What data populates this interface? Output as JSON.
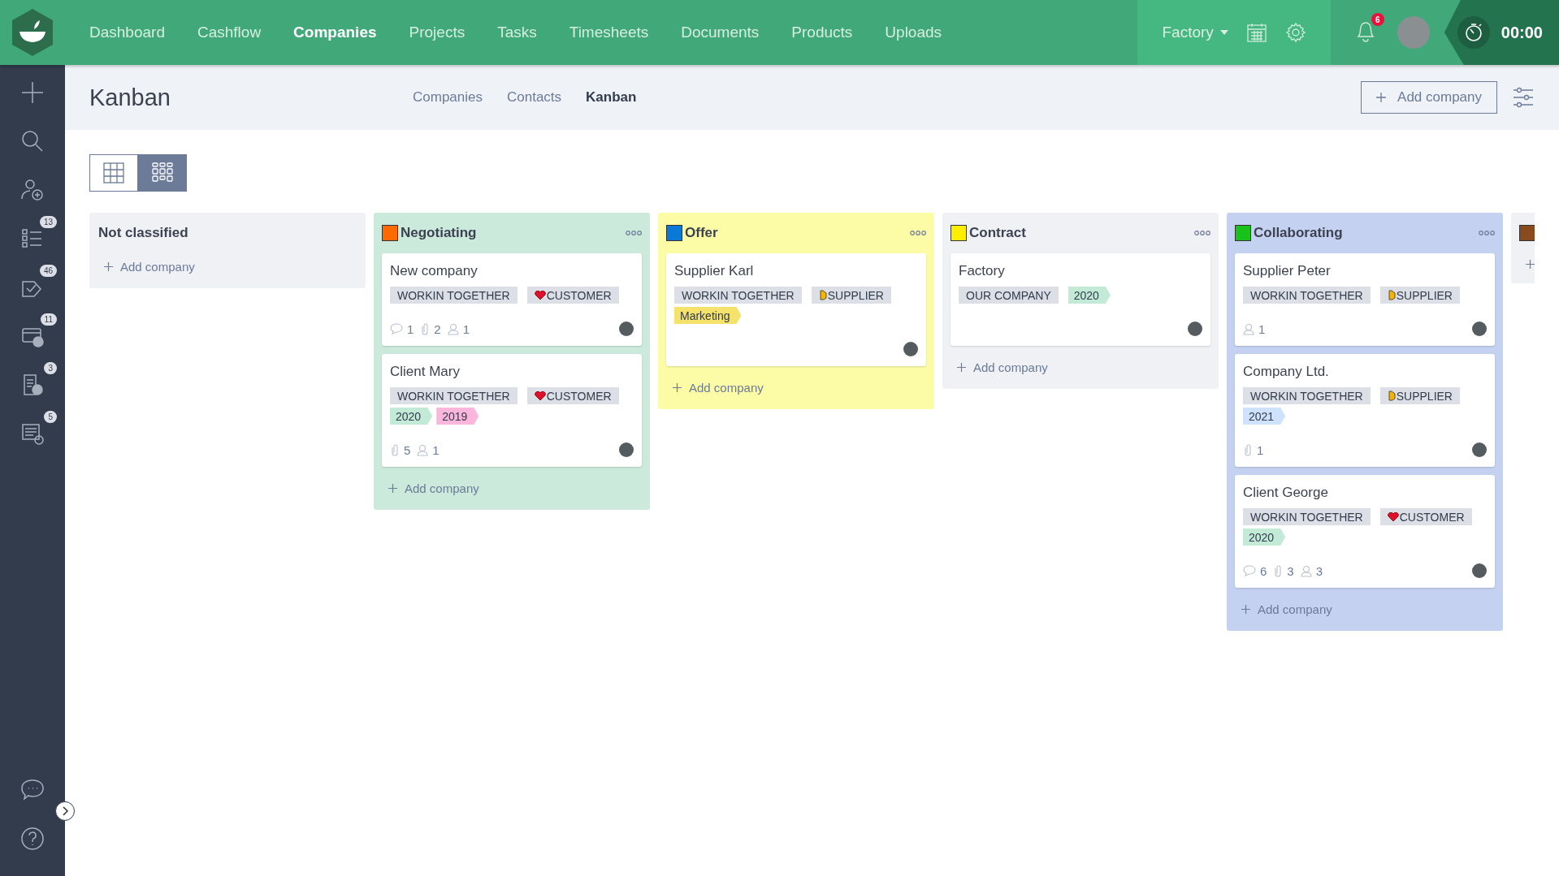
{
  "nav": {
    "items": [
      {
        "label": "Dashboard",
        "selected": false
      },
      {
        "label": "Cashflow",
        "selected": false
      },
      {
        "label": "Companies",
        "selected": true
      },
      {
        "label": "Projects",
        "selected": false
      },
      {
        "label": "Tasks",
        "selected": false
      },
      {
        "label": "Timesheets",
        "selected": false
      },
      {
        "label": "Documents",
        "selected": false
      },
      {
        "label": "Products",
        "selected": false
      },
      {
        "label": "Uploads",
        "selected": false
      }
    ],
    "workspace": "Factory",
    "notifications": "6",
    "timer": "00:00"
  },
  "sidebar": {
    "items": [
      {
        "kind": "add"
      },
      {
        "kind": "search"
      },
      {
        "kind": "contact"
      },
      {
        "kind": "tasks",
        "badge": "13"
      },
      {
        "kind": "approvals",
        "badge": "46"
      },
      {
        "kind": "billing",
        "badge": "11"
      },
      {
        "kind": "document",
        "badge": "3"
      },
      {
        "kind": "timesheet",
        "badge": "5"
      }
    ],
    "bottom": [
      {
        "kind": "chat"
      },
      {
        "kind": "help"
      }
    ]
  },
  "header": {
    "title": "Kanban",
    "tabs": [
      {
        "label": "Companies",
        "selected": false
      },
      {
        "label": "Contacts",
        "selected": false
      },
      {
        "label": "Kanban",
        "selected": true
      }
    ],
    "add_button": "Add company"
  },
  "view_toggle": [
    {
      "kind": "table",
      "selected": false
    },
    {
      "kind": "kanban",
      "selected": true
    }
  ],
  "columns": [
    {
      "title": "Not classified",
      "color": "#eff1f5",
      "menu": false,
      "add_label": "Add company"
    },
    {
      "title": "Negotiating",
      "marker": {
        "color": "#ff6a00"
      },
      "color": "#cbeadb",
      "menu": true,
      "add_label": "Add company",
      "cards": [
        {
          "name": "New company",
          "tags": [
            {
              "kind": "plain",
              "text": "WORKIN TOGETHER"
            },
            {
              "kind": "customer",
              "text": "CUSTOMER"
            }
          ],
          "stats": [
            {
              "kind": "comments",
              "value": "1"
            },
            {
              "kind": "attachments",
              "value": "2"
            },
            {
              "kind": "people",
              "value": "1"
            }
          ]
        },
        {
          "name": "Client Mary",
          "tags": [
            {
              "kind": "plain",
              "text": "WORKIN TOGETHER"
            },
            {
              "kind": "customer",
              "text": "CUSTOMER"
            },
            {
              "kind": "flag",
              "text": "2020",
              "color": "#c3ead6"
            },
            {
              "kind": "flag",
              "text": "2019",
              "color": "#fbb6dc"
            }
          ],
          "stats": [
            {
              "kind": "attachments",
              "value": "5"
            },
            {
              "kind": "people",
              "value": "1"
            }
          ]
        }
      ]
    },
    {
      "title": "Offer",
      "marker": {
        "color": "#0a78d6"
      },
      "color": "#fdfca6",
      "menu": true,
      "add_label": "Add company",
      "cards": [
        {
          "name": "Supplier Karl",
          "tags": [
            {
              "kind": "plain",
              "text": "WORKIN TOGETHER"
            },
            {
              "kind": "supplier",
              "text": "SUPPLIER"
            },
            {
              "kind": "flag",
              "text": "Marketing",
              "color": "#f5e26a"
            }
          ]
        }
      ]
    },
    {
      "title": "Contract",
      "marker": {
        "color": "#ffee00"
      },
      "color": "#eff1f5",
      "menu": true,
      "add_label": "Add company",
      "cards": [
        {
          "name": "Factory",
          "tags": [
            {
              "kind": "plain",
              "text": "OUR COMPANY"
            },
            {
              "kind": "flag",
              "text": "2020",
              "color": "#c3ead6"
            }
          ]
        }
      ]
    },
    {
      "title": "Collaborating",
      "marker": {
        "color": "#18c21a"
      },
      "color": "#c4d1f0",
      "menu": true,
      "add_label": "Add company",
      "cards": [
        {
          "name": "Supplier Peter",
          "tags": [
            {
              "kind": "plain",
              "text": "WORKIN TOGETHER"
            },
            {
              "kind": "supplier",
              "text": "SUPPLIER"
            }
          ],
          "stats": [
            {
              "kind": "people",
              "value": "1"
            }
          ]
        },
        {
          "name": "Company Ltd.",
          "tags": [
            {
              "kind": "plain",
              "text": "WORKIN TOGETHER"
            },
            {
              "kind": "supplier",
              "text": "SUPPLIER"
            },
            {
              "kind": "flag",
              "text": "2021",
              "color": "#cfe2fb"
            }
          ],
          "stats": [
            {
              "kind": "attachments",
              "value": "1"
            }
          ]
        },
        {
          "name": "Client George",
          "tags": [
            {
              "kind": "plain",
              "text": "WORKIN TOGETHER"
            },
            {
              "kind": "customer",
              "text": "CUSTOMER"
            },
            {
              "kind": "flag",
              "text": "2020",
              "color": "#c3ead6"
            }
          ],
          "stats": [
            {
              "kind": "comments",
              "value": "6"
            },
            {
              "kind": "attachments",
              "value": "3"
            },
            {
              "kind": "people",
              "value": "3"
            }
          ]
        }
      ]
    },
    {
      "marker": {
        "color": "#8b4a1e"
      },
      "color": "#eff1f5"
    }
  ]
}
